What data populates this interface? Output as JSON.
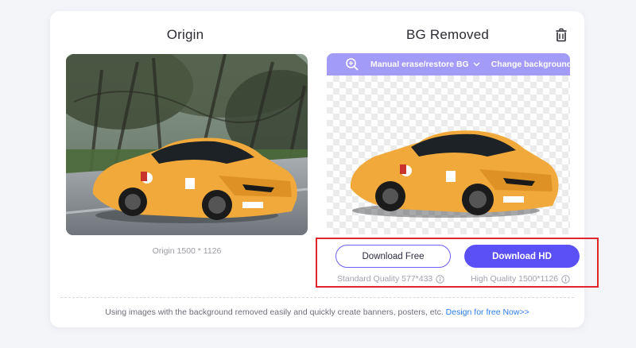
{
  "columns": {
    "origin_title": "Origin",
    "removed_title": "BG Removed"
  },
  "toolbar": {
    "zoom_icon": "zoom-in-icon",
    "erase_label": "Manual erase/restore BG",
    "background_label": "Change background"
  },
  "origin": {
    "caption": "Origin 1500 * 1126"
  },
  "downloads": {
    "free_label": "Download Free",
    "hd_label": "Download HD",
    "free_quality": "Standard Quality 577*433",
    "hd_quality": "High Quality 1500*1126"
  },
  "footer": {
    "text": "Using images with the background removed easily and quickly create banners, posters, etc.",
    "link": "Design for free Now>>"
  },
  "colors": {
    "accent": "#5b4ff6",
    "toolbar": "#a39bf8",
    "highlight": "#e0262c",
    "link": "#2e7ef0"
  }
}
